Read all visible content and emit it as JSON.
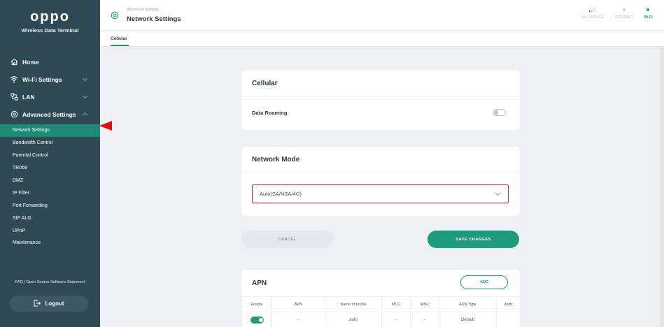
{
  "brand": {
    "logo": "oppo",
    "subtitle": "Wireless Data Terminal"
  },
  "sidebar": {
    "items": [
      {
        "label": "Home",
        "icon": "home-icon",
        "expandable": false
      },
      {
        "label": "Wi-Fi Settings",
        "icon": "wifi-icon",
        "expandable": true
      },
      {
        "label": "LAN",
        "icon": "lan-icon",
        "expandable": true
      },
      {
        "label": "Advanced Settings",
        "icon": "gear-icon",
        "expandable": true,
        "expanded": true
      }
    ],
    "sub_items": [
      "Network Settings",
      "Bandwidth Control",
      "Parental Control",
      "TR069",
      "DMZ",
      "IP Filter",
      "Port Forwarding",
      "SIP ALG",
      "UPnP",
      "Maintenance"
    ],
    "active_sub_item": "Network Settings",
    "faq": "FAQ | Open Source Software Statement",
    "logout": "Logout"
  },
  "header": {
    "breadcrumb": "Advanced Settings",
    "title": "Network Settings",
    "status": [
      {
        "label": "NO SERVICE",
        "icon": "signal-icon",
        "color": "#d0212a"
      },
      {
        "label": "INTERNET",
        "icon": "status-dot-icon",
        "color": "#b8bec2"
      },
      {
        "label": "Wi-Fi",
        "icon": "status-dot-icon",
        "color": "#1f9a7d"
      }
    ]
  },
  "tabs": {
    "active": "Cellular"
  },
  "cellular_card": {
    "title": "Cellular",
    "data_roaming_label": "Data Roaming",
    "data_roaming_on": false
  },
  "network_mode_card": {
    "title": "Network Mode",
    "selected": "Auto(SA/NSA/4G)"
  },
  "buttons": {
    "cancel": "CANCEL",
    "save": "SAVE CHANGES"
  },
  "apn_card": {
    "title": "APN",
    "add_label": "ADD",
    "columns": [
      "Enable",
      "APN",
      "Name of profile",
      "MCC",
      "MNC",
      "APN Type",
      "Auth"
    ],
    "rows": [
      {
        "enabled": true,
        "apn": "-",
        "profile": "auto",
        "mcc": "-",
        "mnc": "-",
        "apn_type": "Default",
        "auth": ""
      }
    ]
  },
  "colors": {
    "accent": "#1f9a7d",
    "sidebar": "#2f4a55",
    "highlight_red": "#d0212a"
  }
}
